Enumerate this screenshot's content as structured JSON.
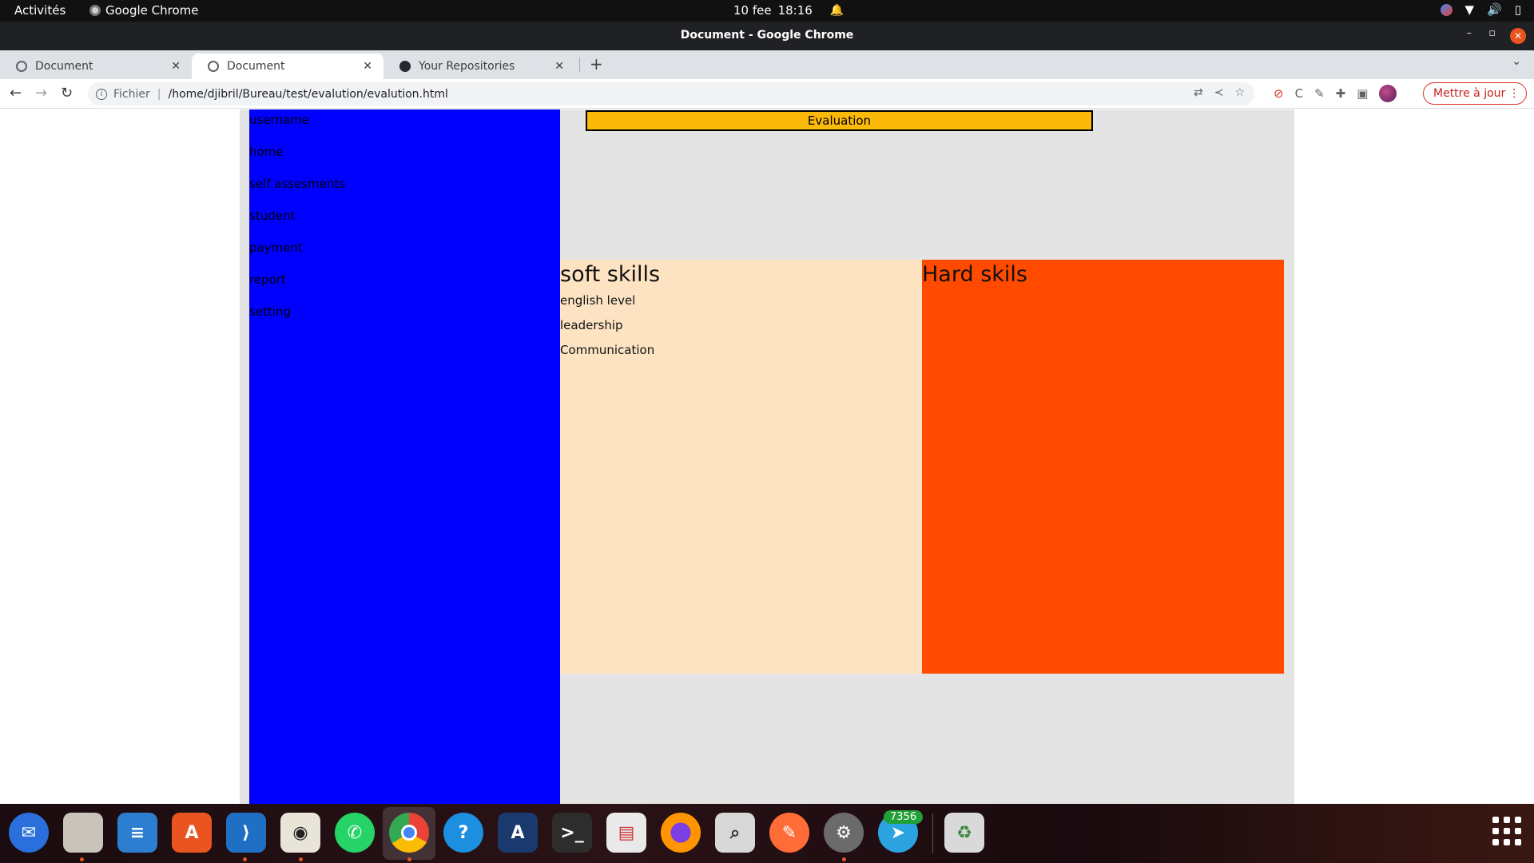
{
  "system_bar": {
    "activities": "Activités",
    "app_name": "Google Chrome",
    "date": "10 fee",
    "time": "18:16"
  },
  "window": {
    "title": "Document - Google Chrome"
  },
  "tabs": [
    {
      "label": "Document",
      "active": false,
      "icon": "globe-icon"
    },
    {
      "label": "Document",
      "active": true,
      "icon": "globe-icon"
    },
    {
      "label": "Your Repositories",
      "active": false,
      "icon": "github-icon"
    }
  ],
  "toolbar": {
    "url_scheme": "Fichier",
    "url": "/home/djibril/Bureau/test/evalution/evalution.html",
    "update_label": "Mettre à jour"
  },
  "page": {
    "sidebar_items": [
      "username",
      "home",
      "self assesments",
      "student",
      "payment",
      "report",
      "setting"
    ],
    "eval_title": "Evaluation",
    "soft": {
      "heading": "soft skills",
      "items": [
        "english level",
        "leadership",
        "Communication"
      ]
    },
    "hard": {
      "heading": "Hard skils"
    }
  },
  "dock": {
    "badge": "7356",
    "apps": [
      "thunderbird",
      "files",
      "libreoffice-writer",
      "app-store",
      "vscode",
      "rhythmbox",
      "whatsapp",
      "chrome",
      "help",
      "algo",
      "terminal",
      "document-viewer",
      "firefox",
      "image-viewer",
      "postman",
      "settings",
      "telegram",
      "trash"
    ]
  },
  "colors": {
    "sidebar": "#0000ff",
    "eval_bar": "#fbb90a",
    "soft_panel": "#fde3c2",
    "hard_panel": "#ff4a00"
  }
}
